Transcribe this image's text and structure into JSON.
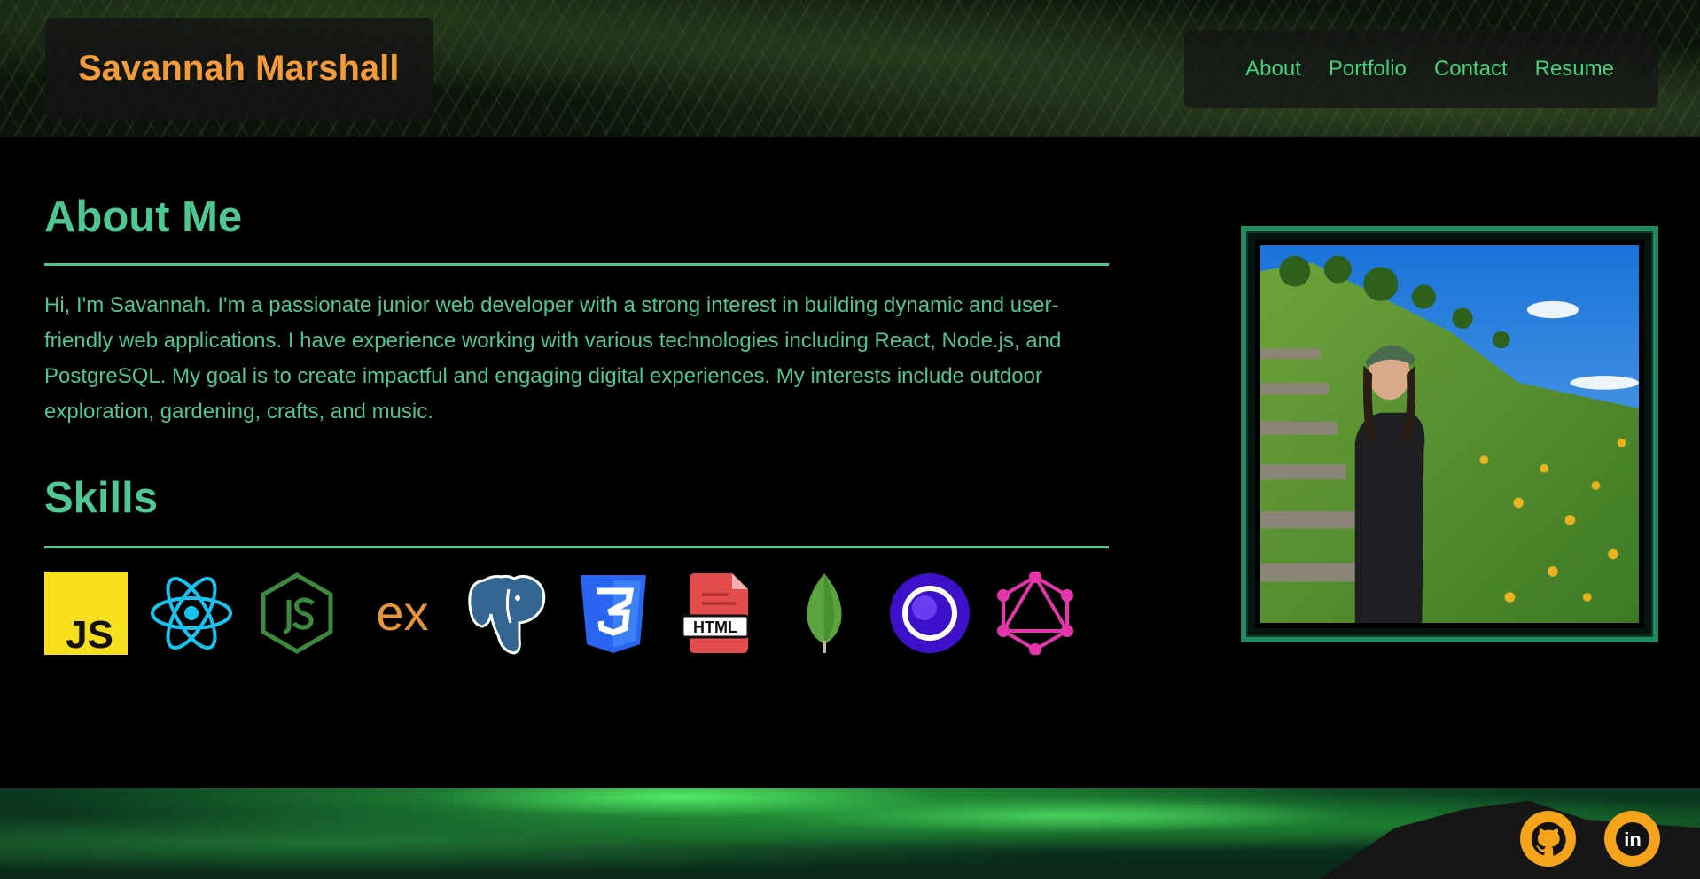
{
  "header": {
    "brand": "Savannah Marshall",
    "nav": [
      "About",
      "Portfolio",
      "Contact",
      "Resume"
    ]
  },
  "about": {
    "title": "About Me",
    "text": "Hi, I'm Savannah. I'm a passionate junior web developer with a strong interest in building dynamic and user-friendly web applications. I have experience working with various technologies including React, Node.js, and PostgreSQL. My goal is to create impactful and engaging digital experiences. My interests include outdoor exploration, gardening, crafts, and music."
  },
  "skills": {
    "title": "Skills",
    "icons": [
      "javascript-icon",
      "react-icon",
      "nodejs-icon",
      "express-icon",
      "postgresql-icon",
      "css3-icon",
      "html-icon",
      "mongodb-icon",
      "apollo-icon",
      "graphql-icon"
    ],
    "js_label": "JS",
    "ex_label": "ex",
    "html_label": "HTML"
  },
  "photo": {
    "alt": "Profile photo"
  },
  "footer": {
    "social": [
      "github-icon",
      "linkedin-icon"
    ],
    "linkedin_label": "in"
  },
  "colors": {
    "accent": "#4fc792",
    "brand": "#f39a3b",
    "nav": "#45d27a",
    "social_bg": "#f5a31a"
  }
}
